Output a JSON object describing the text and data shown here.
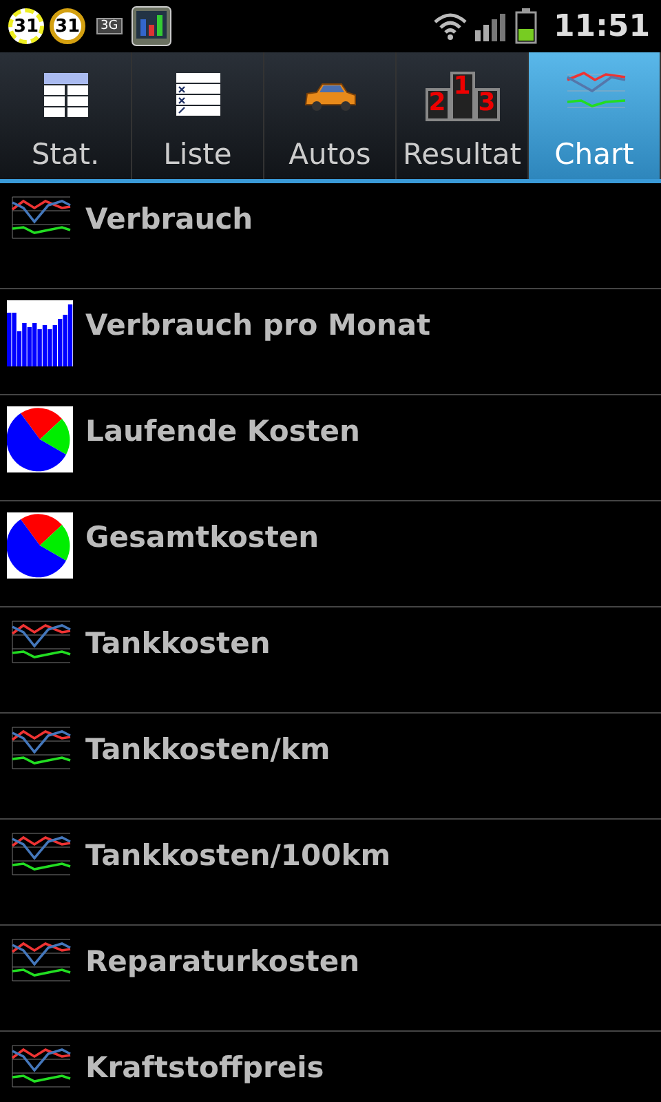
{
  "status_bar": {
    "badges": [
      "31",
      "31"
    ],
    "network": "3G",
    "time": "11:51"
  },
  "tabs": [
    {
      "label": "Stat.",
      "kind": "table",
      "selected": false
    },
    {
      "label": "Liste",
      "kind": "list",
      "selected": false
    },
    {
      "label": "Autos",
      "kind": "car",
      "selected": false
    },
    {
      "label": "Resultat",
      "kind": "podium",
      "selected": false,
      "places": [
        "2",
        "1",
        "3"
      ]
    },
    {
      "label": "Chart",
      "kind": "chart",
      "selected": true
    }
  ],
  "charts": [
    {
      "label": "Verbrauch",
      "kind": "line"
    },
    {
      "label": "Verbrauch pro Monat",
      "kind": "bar"
    },
    {
      "label": "Laufende Kosten",
      "kind": "pie"
    },
    {
      "label": "Gesamtkosten",
      "kind": "pie"
    },
    {
      "label": "Tankkosten",
      "kind": "line"
    },
    {
      "label": "Tankkosten/km",
      "kind": "line"
    },
    {
      "label": "Tankkosten/100km",
      "kind": "line"
    },
    {
      "label": "Reparaturkosten",
      "kind": "line"
    },
    {
      "label": "Kraftstoffpreis",
      "kind": "line"
    }
  ]
}
